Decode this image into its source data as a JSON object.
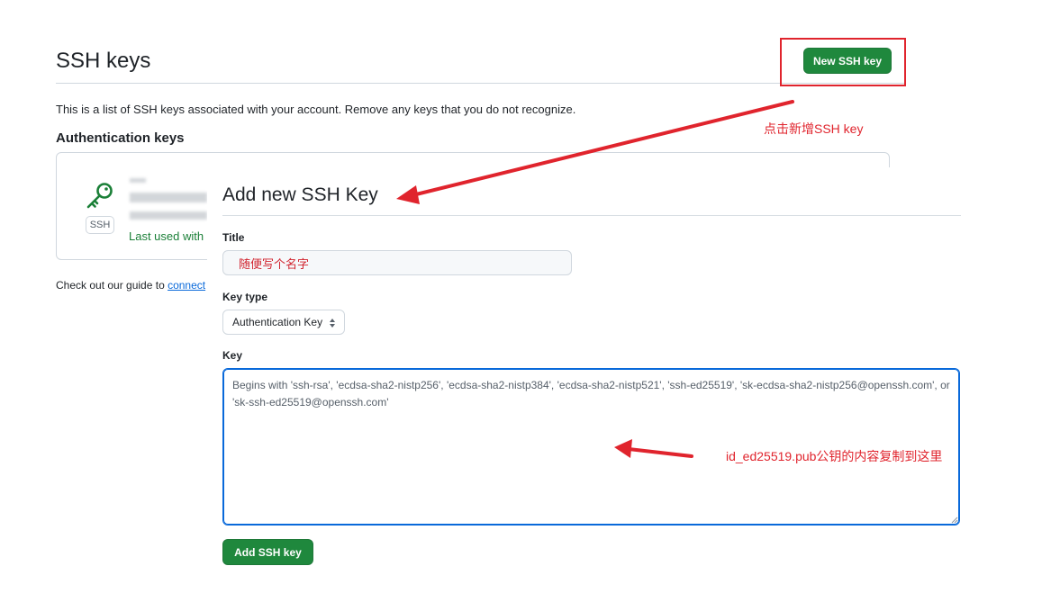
{
  "settings": {
    "title": "SSH keys",
    "new_key_button": "New SSH key",
    "intro": "This is a list of SSH keys associated with your account. Remove any keys that you do not recognize.",
    "section_title": "Authentication keys",
    "key_item": {
      "badge": "SSH",
      "last_used": "Last used with"
    },
    "guide_text": "Check out our guide to ",
    "guide_link": "connect"
  },
  "form": {
    "title": "Add new SSH Key",
    "title_label": "Title",
    "title_value": "随便写个名字",
    "key_type_label": "Key type",
    "key_type_selected": "Authentication Key",
    "key_label": "Key",
    "key_placeholder": "Begins with 'ssh-rsa', 'ecdsa-sha2-nistp256', 'ecdsa-sha2-nistp384', 'ecdsa-sha2-nistp521', 'ssh-ed25519', 'sk-ecdsa-sha2-nistp256@openssh.com', or 'sk-ssh-ed25519@openssh.com'",
    "submit_button": "Add SSH key"
  },
  "annotations": {
    "click_new": "点击新增SSH key",
    "paste_hint": "id_ed25519.pub公钥的内容复制到这里"
  },
  "colors": {
    "primary_button": "#1f883d",
    "annotation_red": "#e0242d",
    "focus_blue": "#0969da",
    "success_green": "#1a7f37"
  },
  "icons": {
    "key": "key-icon",
    "select_chevron": "chevron-updown-icon",
    "arrow": "red-arrow-icon"
  }
}
